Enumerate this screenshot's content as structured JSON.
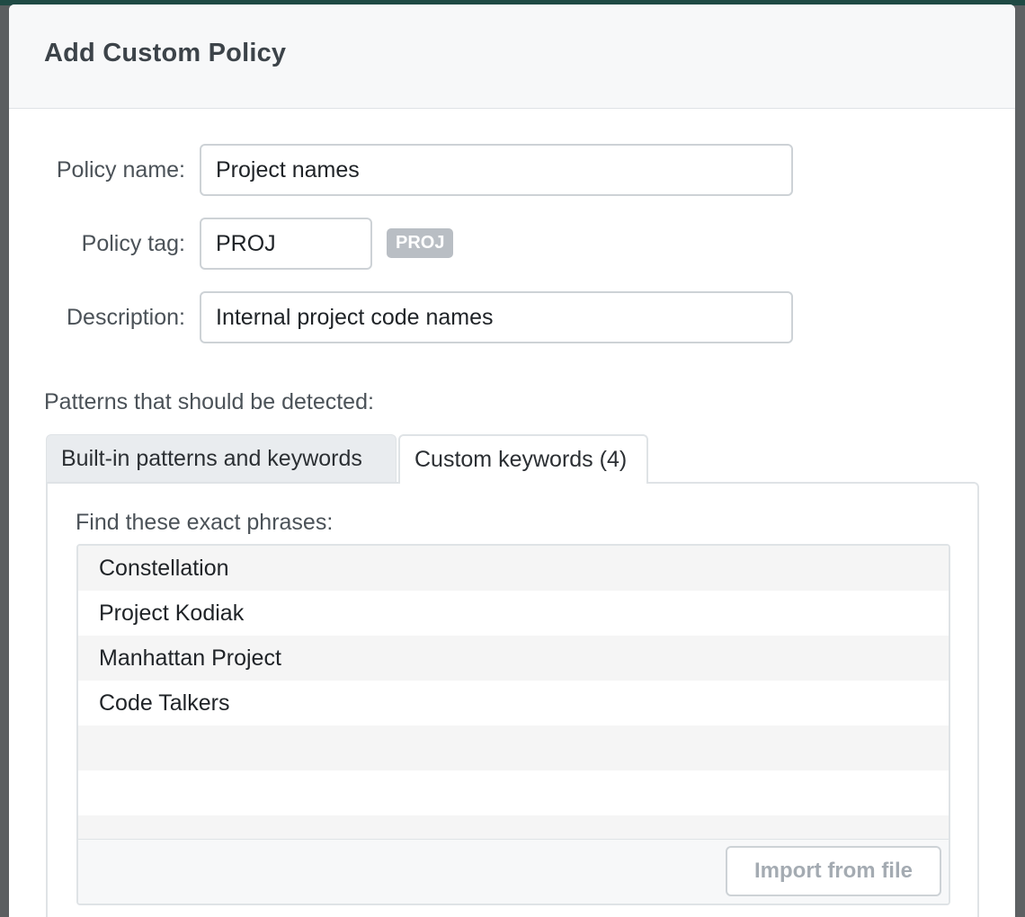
{
  "modal": {
    "title": "Add Custom Policy"
  },
  "form": {
    "policy_name": {
      "label": "Policy name:",
      "value": "Project names"
    },
    "policy_tag": {
      "label": "Policy tag:",
      "value": "PROJ",
      "badge": "PROJ"
    },
    "description": {
      "label": "Description:",
      "value": "Internal project code names"
    }
  },
  "patterns": {
    "section_label": "Patterns that should be detected:",
    "tabs": [
      {
        "label": "Built-in patterns and keywords",
        "active": false
      },
      {
        "label": "Custom keywords (4)",
        "active": true
      }
    ],
    "custom_keywords": {
      "label": "Find these exact phrases:",
      "phrases": [
        "Constellation",
        "Project Kodiak",
        "Manhattan Project",
        "Code Talkers",
        "",
        "",
        ""
      ],
      "import_button": "Import from file"
    }
  },
  "colors": {
    "topbar": "#1f4a44",
    "backdrop": "#5b5e60",
    "badge": "#b9bec4"
  }
}
